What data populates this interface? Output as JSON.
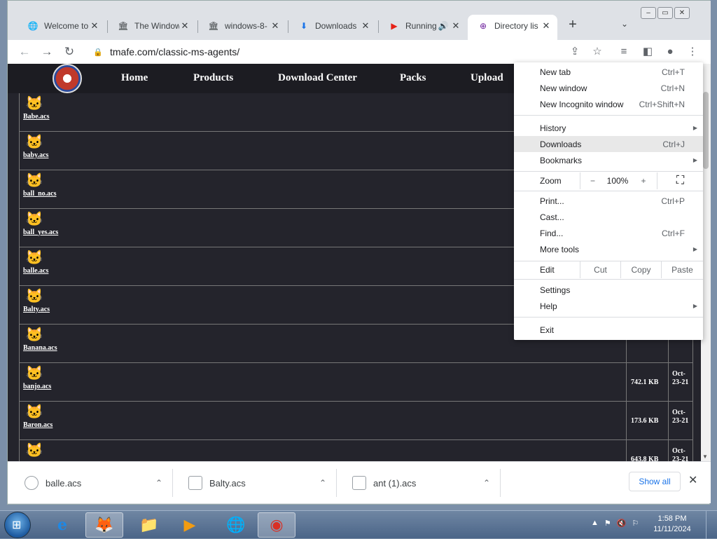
{
  "tabs": [
    {
      "title": "Welcome to",
      "icon": "globe-icon",
      "icon_char": "🌐",
      "close": "✕"
    },
    {
      "title": "The Window",
      "icon": "museum-icon",
      "icon_char": "🏛",
      "close": "✕"
    },
    {
      "title": "windows-8-",
      "icon": "museum-icon",
      "icon_char": "🏛",
      "close": "✕"
    },
    {
      "title": "Downloads",
      "icon": "download-icon",
      "icon_char": "⬇",
      "close": "✕"
    },
    {
      "title": "Running",
      "icon": "youtube-icon",
      "icon_char": "▶",
      "close": "✕",
      "audio": "🔊"
    },
    {
      "title": "Directory lis",
      "icon": "site-favicon-icon",
      "icon_char": "⊕",
      "close": "✕"
    }
  ],
  "new_tab_symbol": "+",
  "tab_search_symbol": "⌄",
  "window_controls": [
    "–",
    "▭",
    "✕"
  ],
  "address": {
    "url": "tmafe.com/classic-ms-agents/",
    "lock": "🔒"
  },
  "nav_symbols": {
    "back": "←",
    "forward": "→",
    "reload": "↻"
  },
  "toolbar_symbols": {
    "share": "⇪",
    "star": "☆",
    "media": "≡",
    "sidepanel": "◧",
    "profile": "●",
    "menu": "⋮"
  },
  "site_nav": [
    "Home",
    "Products",
    "Download Center",
    "Packs",
    "Upload"
  ],
  "files": [
    {
      "name": "Babe.acs",
      "size": "",
      "date": ""
    },
    {
      "name": "baby.acs",
      "size": "",
      "date": ""
    },
    {
      "name": "ball_no.acs",
      "size": "",
      "date": ""
    },
    {
      "name": "ball_yes.acs",
      "size": "",
      "date": ""
    },
    {
      "name": "balle.acs",
      "size": "",
      "date": ""
    },
    {
      "name": "Balty.acs",
      "size": "",
      "date": ""
    },
    {
      "name": "Banana.acs",
      "size": "",
      "date": "21"
    },
    {
      "name": "banjo.acs",
      "size": "742.1 KB",
      "date": "Oct-23-21"
    },
    {
      "name": "Baron.acs",
      "size": "173.6 KB",
      "date": "Oct-23-21"
    },
    {
      "name": "",
      "size": "643.8 KB",
      "date": "Oct-23-21"
    }
  ],
  "file_icon_char": "🐱",
  "menu": {
    "new_tab": "New tab",
    "new_tab_sc": "Ctrl+T",
    "new_window": "New window",
    "new_window_sc": "Ctrl+N",
    "incognito": "New Incognito window",
    "incognito_sc": "Ctrl+Shift+N",
    "history": "History",
    "downloads": "Downloads",
    "downloads_sc": "Ctrl+J",
    "bookmarks": "Bookmarks",
    "zoom": "Zoom",
    "zoom_minus": "−",
    "zoom_value": "100%",
    "zoom_plus": "+",
    "fullscreen": "⛶",
    "print": "Print...",
    "print_sc": "Ctrl+P",
    "cast": "Cast...",
    "find": "Find...",
    "find_sc": "Ctrl+F",
    "more_tools": "More tools",
    "edit": "Edit",
    "cut": "Cut",
    "copy": "Copy",
    "paste": "Paste",
    "settings": "Settings",
    "help": "Help",
    "exit": "Exit",
    "chevron": "▶"
  },
  "downloads": [
    {
      "name": "balle.acs",
      "chevron": "⌃"
    },
    {
      "name": "Balty.acs",
      "chevron": "⌃"
    },
    {
      "name": "ant (1).acs",
      "chevron": "⌃"
    }
  ],
  "show_all": "Show all",
  "shelf_close": "✕",
  "taskbar": {
    "start": "⊞",
    "apps": [
      {
        "name": "internet-explorer",
        "char": "e"
      },
      {
        "name": "firefox",
        "char": "🦊"
      },
      {
        "name": "file-explorer",
        "char": "📁"
      },
      {
        "name": "media-player",
        "char": "▶"
      },
      {
        "name": "app-globe",
        "char": "🌐"
      },
      {
        "name": "chrome",
        "char": "◉"
      }
    ],
    "tray": [
      "▲",
      "⚑",
      "🔇",
      "⚐"
    ],
    "time": "1:58 PM",
    "date": "11/11/2024"
  }
}
